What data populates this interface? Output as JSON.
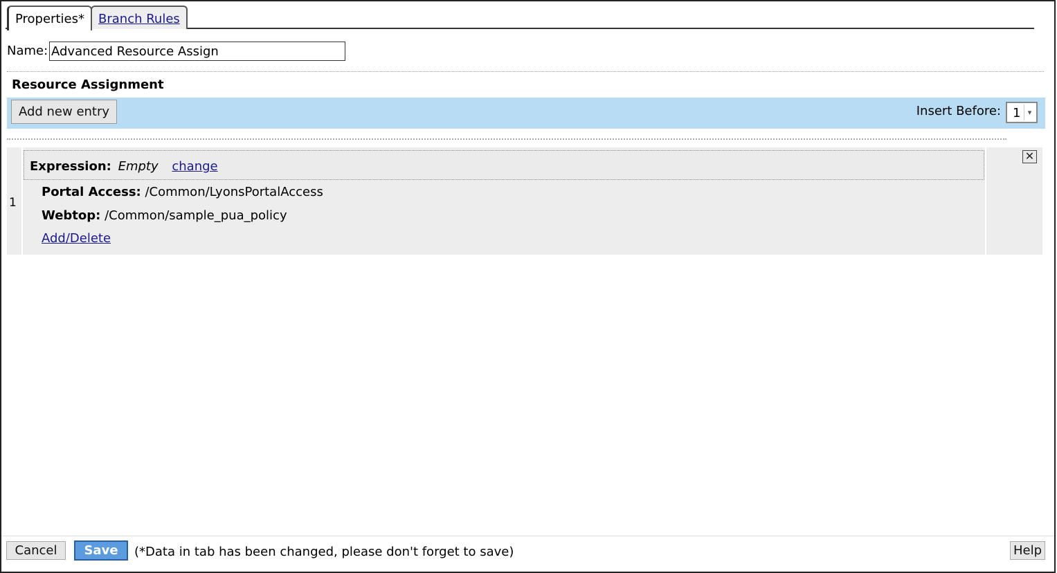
{
  "tabs": [
    {
      "label": "Properties*",
      "active": true
    },
    {
      "label": "Branch Rules",
      "active": false
    }
  ],
  "name": {
    "label": "Name:",
    "value": "Advanced Resource Assign"
  },
  "section": {
    "title": "Resource Assignment"
  },
  "toolbar": {
    "add_label": "Add new entry",
    "insert_label": "Insert Before:",
    "insert_value": "1"
  },
  "entries": [
    {
      "number": "1",
      "expression_label": "Expression:",
      "expression_value": "Empty",
      "change_label": "change",
      "rows": [
        {
          "label": "Portal Access:",
          "value": "/Common/LyonsPortalAccess"
        },
        {
          "label": "Webtop:",
          "value": "/Common/sample_pua_policy"
        }
      ],
      "add_delete_label": "Add/Delete",
      "close_glyph": "✕"
    }
  ],
  "footer": {
    "cancel_label": "Cancel",
    "save_label": "Save",
    "note": "(*Data in tab has been changed, please don't forget to save)",
    "help_label": "Help"
  },
  "colors": {
    "toolbar_bg": "#b7dcf4",
    "entry_bg": "#ededed",
    "save_bg": "#5b9be0",
    "link": "#1a1a8c"
  }
}
